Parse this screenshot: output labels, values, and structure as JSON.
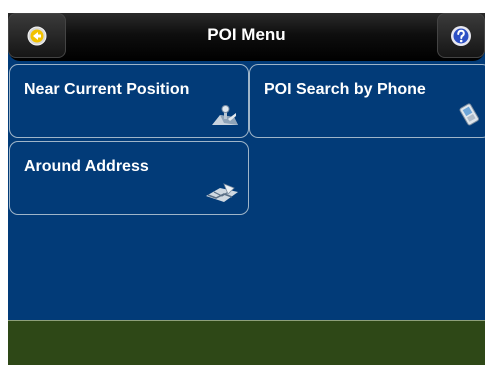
{
  "header": {
    "title": "POI Menu",
    "back_icon": "back-arrow-icon",
    "help_icon": "help-icon"
  },
  "menu": {
    "items": [
      {
        "label": "Near Current Position",
        "icon": "position-icon"
      },
      {
        "label": "POI Search by Phone",
        "icon": "phone-icon"
      },
      {
        "label": "Around Address",
        "icon": "address-icon"
      }
    ]
  },
  "colors": {
    "background": "#023b78",
    "titlebar": "#000000",
    "tile_border": "#9fb5c9",
    "bottombar": "#2e4817"
  }
}
